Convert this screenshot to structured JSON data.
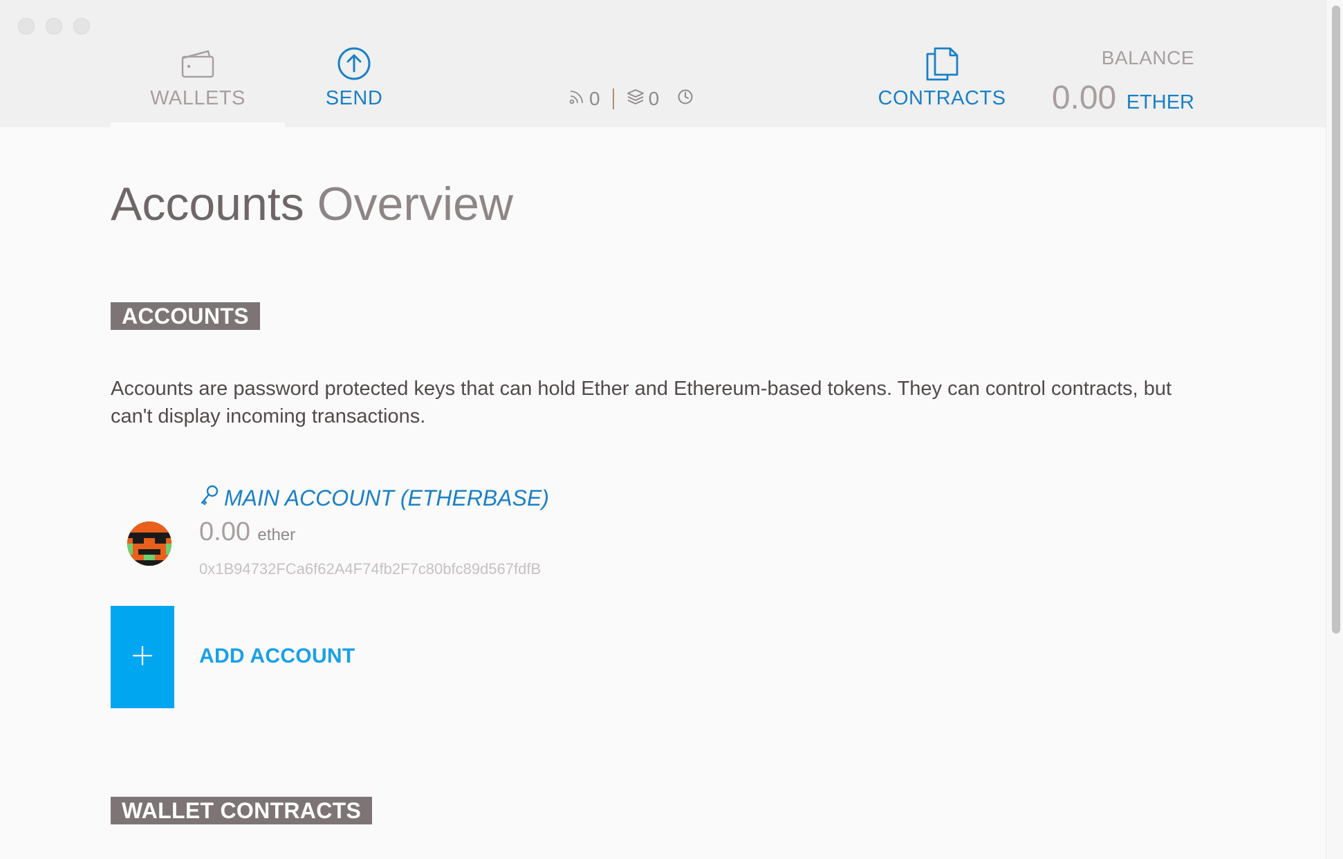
{
  "header": {
    "nav": {
      "wallets_label": "WALLETS",
      "send_label": "SEND",
      "contracts_label": "CONTRACTS"
    },
    "status": {
      "peers": "0",
      "blocks": "0"
    },
    "balance": {
      "title": "BALANCE",
      "amount": "0.00",
      "unit": "ETHER"
    }
  },
  "main": {
    "title_strong": "Accounts",
    "title_light": "Overview",
    "accounts_section": {
      "tag": "ACCOUNTS",
      "description": "Accounts are password protected keys that can hold Ether and Ethereum-based tokens. They can control contracts, but can't display incoming transactions.",
      "items": [
        {
          "name": "MAIN ACCOUNT (ETHERBASE)",
          "balance": "0.00",
          "unit": "ether",
          "address": "0x1B94732FCa6f62A4F74fb2F7c80bfc89d567fdfB"
        }
      ],
      "add_label": "ADD ACCOUNT"
    },
    "wallets_section": {
      "tag": "WALLET CONTRACTS"
    }
  },
  "colors": {
    "accent": "#1a80c6",
    "add_button": "#00a6f0",
    "tag_bg": "#7d7575",
    "header_bg": "#f0f0f0"
  },
  "icons": [
    "wallet-icon",
    "send-arrow-icon",
    "peers-signal-icon",
    "blocks-layers-icon",
    "clock-icon",
    "contracts-document-icon",
    "key-icon",
    "plus-icon"
  ]
}
